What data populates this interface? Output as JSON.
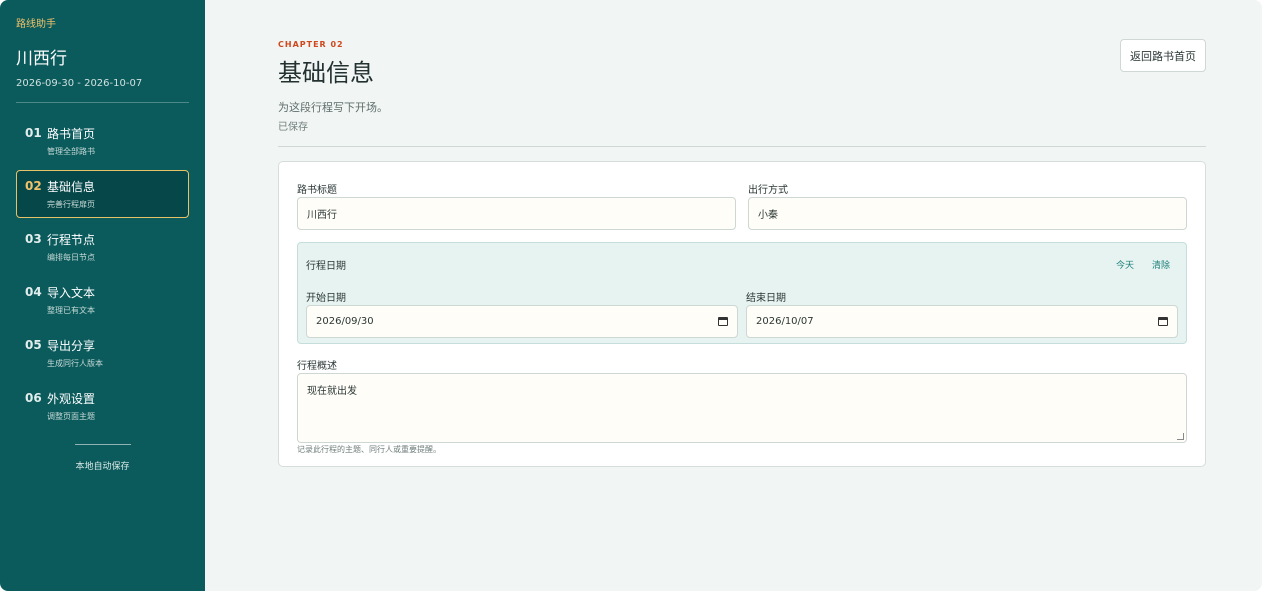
{
  "sidebar": {
    "brand": "路线助手",
    "trip_title": "川西行",
    "trip_dates": "2026-09-30 - 2026-10-07",
    "items": [
      {
        "num": "01",
        "label": "路书首页",
        "sub": "管理全部路书"
      },
      {
        "num": "02",
        "label": "基础信息",
        "sub": "完善行程扉页"
      },
      {
        "num": "03",
        "label": "行程节点",
        "sub": "编排每日节点"
      },
      {
        "num": "04",
        "label": "导入文本",
        "sub": "整理已有文本"
      },
      {
        "num": "05",
        "label": "导出分享",
        "sub": "生成同行人版本"
      },
      {
        "num": "06",
        "label": "外观设置",
        "sub": "调整页面主题"
      }
    ],
    "active_index": 1,
    "footer": "本地自动保存"
  },
  "header": {
    "chapter": "CHAPTER 02",
    "title": "基础信息",
    "description": "为这段行程写下开场。",
    "save_status": "已保存",
    "back_button": "返回路书首页"
  },
  "form": {
    "title_label": "路书标题",
    "title_value": "川西行",
    "travel_label": "出行方式",
    "travel_value": "小秦",
    "dates": {
      "section_label": "行程日期",
      "today": "今天",
      "clear": "清除",
      "start_label": "开始日期",
      "start_value": "2026/09/30",
      "end_label": "结束日期",
      "end_value": "2026/10/07"
    },
    "summary_label": "行程概述",
    "summary_value": "现在就出发",
    "summary_hint": "记录此行程的主题、同行人或重要提醒。"
  },
  "colors": {
    "sidebar_bg": "#0b5a5c",
    "accent": "#f0c36a",
    "chapter": "#d0481e",
    "link": "#1c7f78"
  }
}
